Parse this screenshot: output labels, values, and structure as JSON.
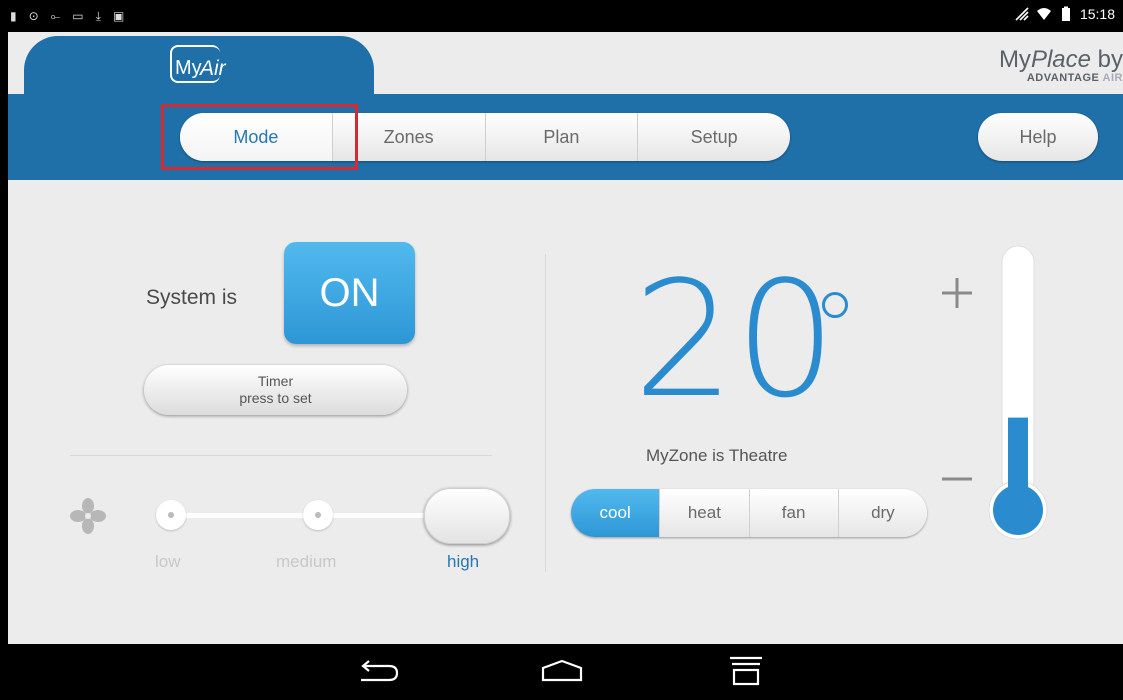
{
  "statusbar": {
    "clock": "15:18"
  },
  "brand": {
    "my": "My",
    "air": "Air",
    "myplace_prefix": "My",
    "myplace_italic": "Place",
    "myplace_suffix": " by",
    "company_dark": "ADVANTAGE ",
    "company_light": "AIR"
  },
  "nav": {
    "tabs": [
      {
        "label": "Mode"
      },
      {
        "label": "Zones"
      },
      {
        "label": "Plan"
      },
      {
        "label": "Setup"
      }
    ],
    "active_tab": "Mode",
    "help_label": "Help"
  },
  "system": {
    "label": "System is",
    "state": "ON",
    "timer_line1": "Timer",
    "timer_line2": "press to set"
  },
  "fan": {
    "speeds": [
      {
        "label": "low"
      },
      {
        "label": "medium"
      },
      {
        "label": "high"
      }
    ],
    "selected": "high"
  },
  "temperature": {
    "value": "20",
    "zone_text": "MyZone is Theatre",
    "setpoint_fraction": 0.35
  },
  "modes": {
    "options": [
      {
        "label": "cool"
      },
      {
        "label": "heat"
      },
      {
        "label": "fan"
      },
      {
        "label": "dry"
      }
    ],
    "selected": "cool"
  },
  "colors": {
    "brand_blue": "#1f6fa8",
    "accent_blue": "#2a8ccf",
    "highlight_red": "#d42a32"
  }
}
